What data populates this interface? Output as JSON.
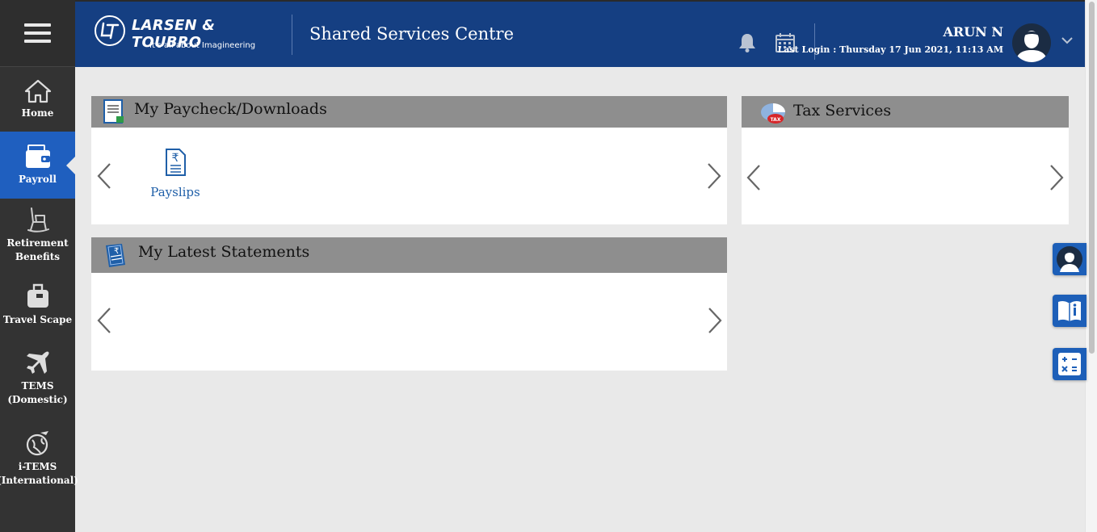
{
  "sidebar": {
    "menu_icon": "hamburger-icon",
    "items": [
      {
        "label": "Home",
        "icon": "home-icon"
      },
      {
        "label": "Payroll",
        "icon": "wallet-icon",
        "active": true
      },
      {
        "label": "Retirement Benefits",
        "icon": "rocking-chair-icon"
      },
      {
        "label": "Travel Scape",
        "icon": "luggage-icon"
      },
      {
        "label": "TEMS (Domestic)",
        "icon": "airplane-icon"
      },
      {
        "label": "i-TEMS (International)",
        "icon": "globe-plane-icon"
      }
    ]
  },
  "header": {
    "brand": "LARSEN & TOUBRO",
    "tagline": "It's all about Imagineering",
    "app_title": "Shared Services Centre",
    "user_name": "ARUN N",
    "last_login": "Last Login : Thursday 17 Jun 2021, 11:13 AM",
    "icons": [
      "bell-icon",
      "calendar-icon",
      "user-avatar",
      "chevron-down-icon"
    ]
  },
  "cards": {
    "paycheck": {
      "title": "My Paycheck/Downloads",
      "items": [
        {
          "label": "Payslips",
          "icon": "rupee-document-icon"
        }
      ]
    },
    "tax": {
      "title": "Tax Services"
    },
    "statements": {
      "title": "My Latest Statements"
    }
  },
  "floating_buttons": [
    "support-agent-icon",
    "info-book-icon",
    "calculator-icon"
  ],
  "colors": {
    "header_bg": "#153f82",
    "sidebar_bg": "#333333",
    "active_nav": "#1f5fbf",
    "card_header": "#8e8e8e",
    "link_blue": "#1f5fa8"
  }
}
